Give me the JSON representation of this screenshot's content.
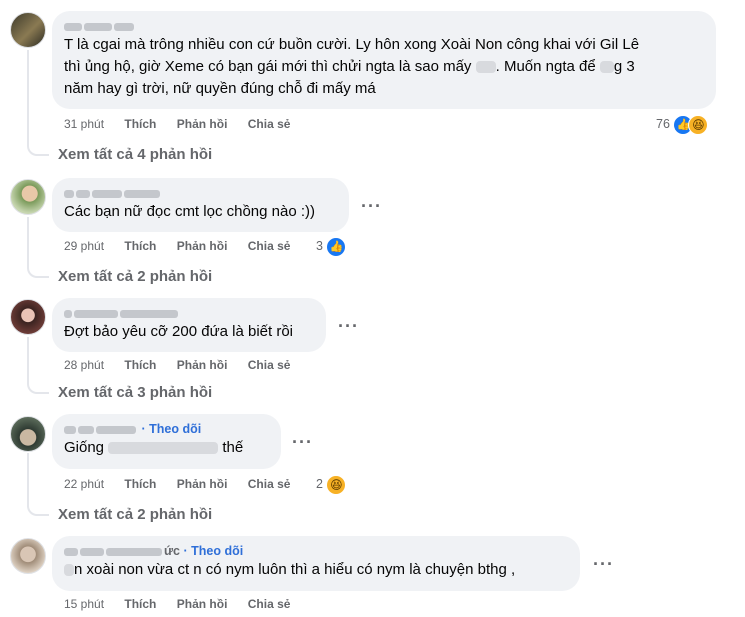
{
  "comments": [
    {
      "author": "",
      "text_line1": "T là cgai mà trông nhiều con cứ buồn cười. Ly hôn xong Xoài Non công khai với Gil Lê",
      "text_line2a": "thì ủng hộ, giờ Xeme có bạn gái mới thì chửi ngta là sao mấy ",
      "text_line2b": ". Muốn ngta để ",
      "text_line2c": "g 3",
      "text_line3": "năm hay gì trời, nữ quyền đúng chỗ đi mấy má",
      "time": "31 phút",
      "like": "Thích",
      "reply": "Phản hồi",
      "share": "Chia sẻ",
      "reaction_count": "76",
      "view_replies": "Xem tất cả 4 phản hồi"
    },
    {
      "author": "",
      "text": "Các bạn nữ đọc cmt lọc chồng nào :))",
      "time": "29 phút",
      "like": "Thích",
      "reply": "Phản hồi",
      "share": "Chia sẻ",
      "reaction_count": "3",
      "view_replies": "Xem tất cả 2 phản hồi"
    },
    {
      "author": "",
      "text": "Đợt bảo yêu cỡ 200 đứa là biết rồi",
      "time": "28 phút",
      "like": "Thích",
      "reply": "Phản hồi",
      "share": "Chia sẻ",
      "view_replies": "Xem tất cả 3 phản hồi"
    },
    {
      "author": "",
      "follow": "· Theo dõi",
      "text_start": "Giống",
      "text_end": "thế",
      "time": "22 phút",
      "like": "Thích",
      "reply": "Phản hồi",
      "share": "Chia sẻ",
      "reaction_count": "2",
      "view_replies": "Xem tất cả 2 phản hồi"
    },
    {
      "author_suffix": "ức",
      "follow": "· Theo dõi",
      "text": "n xoài non vừa ct n có nym luôn thì a hiểu có nym là chuyện bthg ,",
      "time": "15 phút",
      "like": "Thích",
      "reply": "Phản hồi",
      "share": "Chia sẻ"
    }
  ],
  "icons": {
    "more": "more-options-icon",
    "like": "like-reaction-icon",
    "haha": "haha-reaction-icon"
  },
  "colors": {
    "bubble": "#f0f2f5",
    "meta": "#65676b",
    "follow": "#2f6fd8",
    "like": "#1877f2",
    "haha": "#f7b125"
  }
}
